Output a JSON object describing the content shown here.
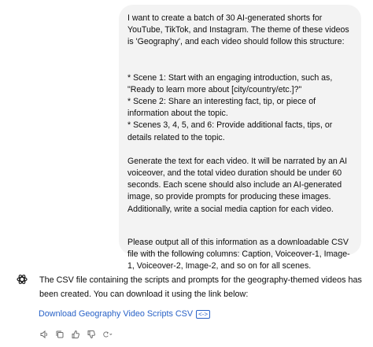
{
  "user_message": {
    "para1": "I want to create a batch of 30 AI-generated shorts for YouTube, TikTok, and Instagram. The theme of these videos is 'Geography', and each video should follow this structure:",
    "para2": "* Scene 1: Start with an engaging introduction, such as, \"Ready to learn more about [city/country/etc.]?\"\n* Scene 2: Share an interesting fact, tip, or piece of information about the topic.\n* Scenes 3, 4, 5, and 6: Provide additional facts, tips, or details related to the topic.",
    "para3": "Generate the text for each video. It will be narrated by an AI voiceover, and the total video duration should be under 60 seconds. Each scene should also include an AI-generated image, so provide prompts for producing these images. Additionally, write a social media caption for each video.",
    "para4": "Please output all of this information as a downloadable CSV file with the following columns: Caption, Voiceover-1, Image-1, Voiceover-2, Image-2, and so on for all scenes."
  },
  "assistant_message": {
    "text": "The CSV file containing the scripts and prompts for the geography-themed videos has been created. You can download it using the link below:",
    "link_label": "Download Geography Video Scripts CSV",
    "link_icon": "code-icon"
  },
  "actions": [
    "read-aloud-icon",
    "copy-icon",
    "thumbs-up-icon",
    "thumbs-down-icon",
    "regenerate-icon"
  ],
  "colors": {
    "bubble": "#f3f3f3",
    "link": "#2962c7",
    "icon": "#6b6b6b"
  }
}
